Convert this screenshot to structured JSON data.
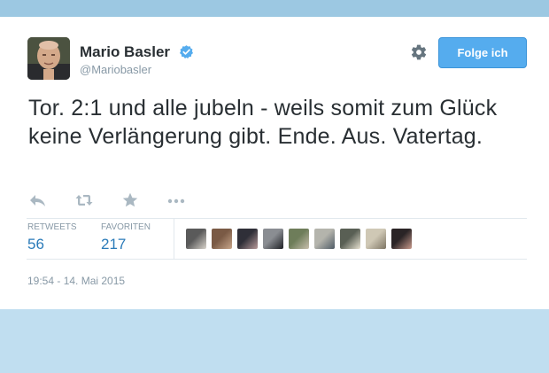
{
  "tweet": {
    "author_name": "Mario Basler",
    "author_handle": "@Mariobasler",
    "follow_label": "Folge ich",
    "text": "Tor. 2:1 und alle jubeln - weils somit zum Glück keine Verlängerung gibt. Ende. Aus. Vatertag.",
    "retweets_label": "RETWEETS",
    "retweets_count": "56",
    "favorites_label": "FAVORITEN",
    "favorites_count": "217",
    "timestamp": "19:54 - 14. Mai 2015"
  },
  "icons": {
    "verified": "verified-badge-icon",
    "settings": "gear-icon",
    "reply": "reply-icon",
    "retweet": "retweet-icon",
    "favorite": "star-icon",
    "more": "more-dots-icon"
  },
  "colors": {
    "accent": "#55acee",
    "link": "#2b7bb9",
    "text": "#292f33",
    "muted": "#8899a6",
    "background": "#c0def0"
  },
  "favoriter_avatars": [
    {
      "colors": [
        "#5a5a5a",
        "#d9d4cc"
      ]
    },
    {
      "colors": [
        "#7a5a45",
        "#c8a68a"
      ]
    },
    {
      "colors": [
        "#2f2f38",
        "#b89a9a"
      ]
    },
    {
      "colors": [
        "#8a8d92",
        "#1d1f24"
      ]
    },
    {
      "colors": [
        "#6e7d5a",
        "#c9bfae"
      ]
    },
    {
      "colors": [
        "#b4b4ac",
        "#4f5b66"
      ]
    },
    {
      "colors": [
        "#595f54",
        "#e8e2d2"
      ]
    },
    {
      "colors": [
        "#cfc8b5",
        "#7d7463"
      ]
    },
    {
      "colors": [
        "#2a2426",
        "#c99a8c"
      ]
    }
  ]
}
